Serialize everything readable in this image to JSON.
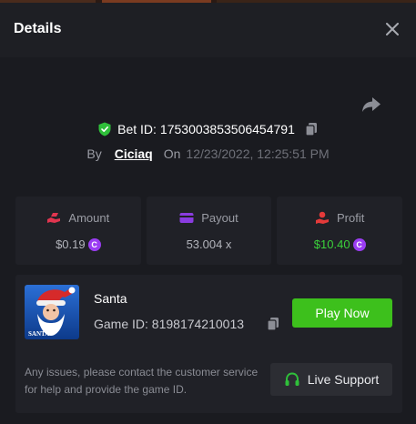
{
  "header": {
    "title": "Details"
  },
  "bet": {
    "label": "Bet ID:",
    "id": "1753003853506454791"
  },
  "byline": {
    "by_label": "By",
    "username": "Ciciaq",
    "on_label": "On",
    "datetime": "12/23/2022, 12:25:51 PM"
  },
  "stats": [
    {
      "label": "Amount",
      "value": "$0.19",
      "icon": "bet-hand-icon",
      "coin": true
    },
    {
      "label": "Payout",
      "value": "53.004 x",
      "icon": "wallet-icon",
      "coin": false
    },
    {
      "label": "Profit",
      "value": "$10.40",
      "icon": "profit-hand-icon",
      "coin": true
    }
  ],
  "coin_symbol": "C",
  "game": {
    "name": "Santa",
    "id_label": "Game ID:",
    "id": "8198174210013",
    "play_label": "Play Now",
    "thumb_text": "SANTA"
  },
  "support": {
    "help_text": "Any issues, please contact the customer service for help and provide the game ID.",
    "button_label": "Live Support"
  },
  "colors": {
    "accent_green": "#3dc01c",
    "profit_green": "#3bd23b",
    "coin_purple": "#9b3df3",
    "amount_pink": "#e0354f",
    "payout_purple": "#8a3ce0",
    "profit_red": "#e43a3a"
  }
}
